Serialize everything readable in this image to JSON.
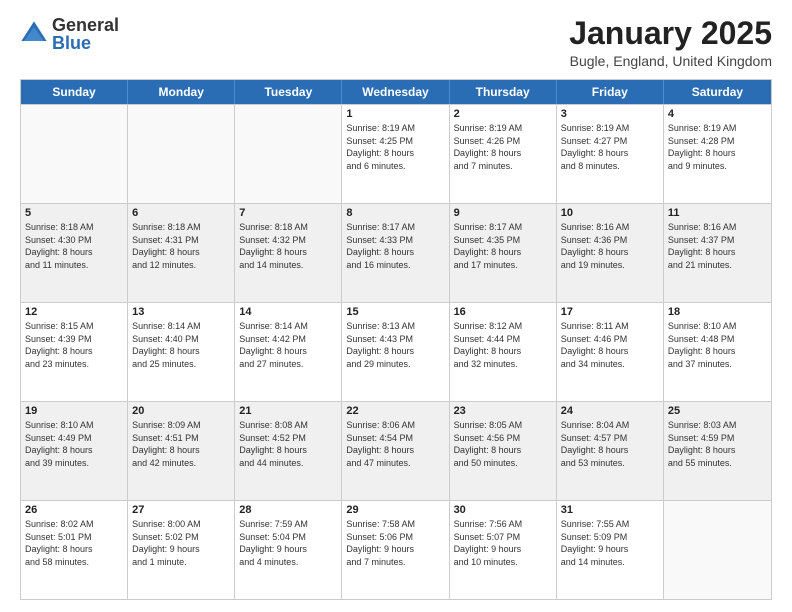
{
  "header": {
    "logo_general": "General",
    "logo_blue": "Blue",
    "title": "January 2025",
    "subtitle": "Bugle, England, United Kingdom"
  },
  "weekdays": [
    "Sunday",
    "Monday",
    "Tuesday",
    "Wednesday",
    "Thursday",
    "Friday",
    "Saturday"
  ],
  "weeks": [
    [
      {
        "day": "",
        "info": "",
        "empty": true
      },
      {
        "day": "",
        "info": "",
        "empty": true
      },
      {
        "day": "",
        "info": "",
        "empty": true
      },
      {
        "day": "1",
        "info": "Sunrise: 8:19 AM\nSunset: 4:25 PM\nDaylight: 8 hours\nand 6 minutes.",
        "empty": false
      },
      {
        "day": "2",
        "info": "Sunrise: 8:19 AM\nSunset: 4:26 PM\nDaylight: 8 hours\nand 7 minutes.",
        "empty": false
      },
      {
        "day": "3",
        "info": "Sunrise: 8:19 AM\nSunset: 4:27 PM\nDaylight: 8 hours\nand 8 minutes.",
        "empty": false
      },
      {
        "day": "4",
        "info": "Sunrise: 8:19 AM\nSunset: 4:28 PM\nDaylight: 8 hours\nand 9 minutes.",
        "empty": false
      }
    ],
    [
      {
        "day": "5",
        "info": "Sunrise: 8:18 AM\nSunset: 4:30 PM\nDaylight: 8 hours\nand 11 minutes.",
        "empty": false
      },
      {
        "day": "6",
        "info": "Sunrise: 8:18 AM\nSunset: 4:31 PM\nDaylight: 8 hours\nand 12 minutes.",
        "empty": false
      },
      {
        "day": "7",
        "info": "Sunrise: 8:18 AM\nSunset: 4:32 PM\nDaylight: 8 hours\nand 14 minutes.",
        "empty": false
      },
      {
        "day": "8",
        "info": "Sunrise: 8:17 AM\nSunset: 4:33 PM\nDaylight: 8 hours\nand 16 minutes.",
        "empty": false
      },
      {
        "day": "9",
        "info": "Sunrise: 8:17 AM\nSunset: 4:35 PM\nDaylight: 8 hours\nand 17 minutes.",
        "empty": false
      },
      {
        "day": "10",
        "info": "Sunrise: 8:16 AM\nSunset: 4:36 PM\nDaylight: 8 hours\nand 19 minutes.",
        "empty": false
      },
      {
        "day": "11",
        "info": "Sunrise: 8:16 AM\nSunset: 4:37 PM\nDaylight: 8 hours\nand 21 minutes.",
        "empty": false
      }
    ],
    [
      {
        "day": "12",
        "info": "Sunrise: 8:15 AM\nSunset: 4:39 PM\nDaylight: 8 hours\nand 23 minutes.",
        "empty": false
      },
      {
        "day": "13",
        "info": "Sunrise: 8:14 AM\nSunset: 4:40 PM\nDaylight: 8 hours\nand 25 minutes.",
        "empty": false
      },
      {
        "day": "14",
        "info": "Sunrise: 8:14 AM\nSunset: 4:42 PM\nDaylight: 8 hours\nand 27 minutes.",
        "empty": false
      },
      {
        "day": "15",
        "info": "Sunrise: 8:13 AM\nSunset: 4:43 PM\nDaylight: 8 hours\nand 29 minutes.",
        "empty": false
      },
      {
        "day": "16",
        "info": "Sunrise: 8:12 AM\nSunset: 4:44 PM\nDaylight: 8 hours\nand 32 minutes.",
        "empty": false
      },
      {
        "day": "17",
        "info": "Sunrise: 8:11 AM\nSunset: 4:46 PM\nDaylight: 8 hours\nand 34 minutes.",
        "empty": false
      },
      {
        "day": "18",
        "info": "Sunrise: 8:10 AM\nSunset: 4:48 PM\nDaylight: 8 hours\nand 37 minutes.",
        "empty": false
      }
    ],
    [
      {
        "day": "19",
        "info": "Sunrise: 8:10 AM\nSunset: 4:49 PM\nDaylight: 8 hours\nand 39 minutes.",
        "empty": false
      },
      {
        "day": "20",
        "info": "Sunrise: 8:09 AM\nSunset: 4:51 PM\nDaylight: 8 hours\nand 42 minutes.",
        "empty": false
      },
      {
        "day": "21",
        "info": "Sunrise: 8:08 AM\nSunset: 4:52 PM\nDaylight: 8 hours\nand 44 minutes.",
        "empty": false
      },
      {
        "day": "22",
        "info": "Sunrise: 8:06 AM\nSunset: 4:54 PM\nDaylight: 8 hours\nand 47 minutes.",
        "empty": false
      },
      {
        "day": "23",
        "info": "Sunrise: 8:05 AM\nSunset: 4:56 PM\nDaylight: 8 hours\nand 50 minutes.",
        "empty": false
      },
      {
        "day": "24",
        "info": "Sunrise: 8:04 AM\nSunset: 4:57 PM\nDaylight: 8 hours\nand 53 minutes.",
        "empty": false
      },
      {
        "day": "25",
        "info": "Sunrise: 8:03 AM\nSunset: 4:59 PM\nDaylight: 8 hours\nand 55 minutes.",
        "empty": false
      }
    ],
    [
      {
        "day": "26",
        "info": "Sunrise: 8:02 AM\nSunset: 5:01 PM\nDaylight: 8 hours\nand 58 minutes.",
        "empty": false
      },
      {
        "day": "27",
        "info": "Sunrise: 8:00 AM\nSunset: 5:02 PM\nDaylight: 9 hours\nand 1 minute.",
        "empty": false
      },
      {
        "day": "28",
        "info": "Sunrise: 7:59 AM\nSunset: 5:04 PM\nDaylight: 9 hours\nand 4 minutes.",
        "empty": false
      },
      {
        "day": "29",
        "info": "Sunrise: 7:58 AM\nSunset: 5:06 PM\nDaylight: 9 hours\nand 7 minutes.",
        "empty": false
      },
      {
        "day": "30",
        "info": "Sunrise: 7:56 AM\nSunset: 5:07 PM\nDaylight: 9 hours\nand 10 minutes.",
        "empty": false
      },
      {
        "day": "31",
        "info": "Sunrise: 7:55 AM\nSunset: 5:09 PM\nDaylight: 9 hours\nand 14 minutes.",
        "empty": false
      },
      {
        "day": "",
        "info": "",
        "empty": true
      }
    ]
  ]
}
